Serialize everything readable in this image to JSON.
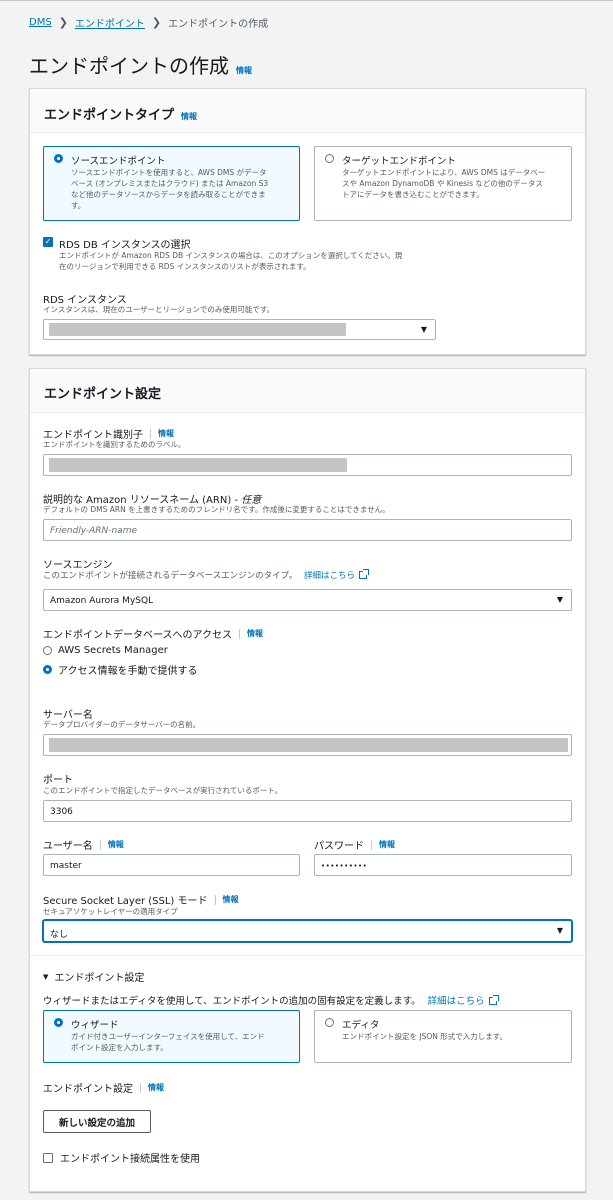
{
  "breadcrumb": {
    "root": "DMS",
    "parent": "エンドポイント",
    "current": "エンドポイントの作成"
  },
  "page": {
    "title": "エンドポイントの作成",
    "info": "情報"
  },
  "endpoint_type": {
    "title": "エンドポイントタイプ",
    "info": "情報",
    "source": {
      "title": "ソースエンドポイント",
      "desc1": "ソースエンドポイントを使用すると、AWS DMS がデータ",
      "desc2": "ベース (オンプレミスまたはクラウド) または Amazon S3",
      "desc3": "など他のデータソースからデータを読み取ることができま",
      "desc4": "す。"
    },
    "target": {
      "title": "ターゲットエンドポイント",
      "desc1": "ターゲットエンドポイントにより、AWS DMS はデータベー",
      "desc2": "スや Amazon DynamoDB や Kinesis などの他のデータス",
      "desc3": "トアにデータを書き込むことができます。"
    },
    "rds_select": {
      "label": "RDS DB インスタンスの選択",
      "desc1": "エンドポイントが Amazon RDS DB インスタンスの場合は、このオプションを選択してください。現",
      "desc2": "在のリージョンで利用できる RDS インスタンスのリストが表示されます。"
    },
    "rds_instance": {
      "label": "RDS インスタンス",
      "desc": "インスタンスは、現在のユーザーとリージョンでのみ使用可能です。"
    }
  },
  "endpoint_settings": {
    "title": "エンドポイント設定",
    "identifier": {
      "label": "エンドポイント識別子",
      "info": "情報",
      "desc": "エンドポイントを識別するためのラベル。"
    },
    "arn": {
      "label": "説明的な Amazon リソースネーム (ARN) -",
      "optional": "任意",
      "desc": "デフォルトの DMS ARN を上書きするためのフレンドリ名です。作成後に変更することはできません。",
      "placeholder": "Friendly-ARN-name"
    },
    "engine": {
      "label": "ソースエンジン",
      "desc": "このエンドポイントが接続されるデータベースエンジンのタイプ。",
      "learn_more": "詳細はこちら",
      "value": "Amazon Aurora MySQL"
    },
    "access": {
      "label": "エンドポイントデータベースへのアクセス",
      "info": "情報",
      "opt1": "AWS Secrets Manager",
      "opt2": "アクセス情報を手動で提供する"
    },
    "server": {
      "label": "サーバー名",
      "desc": "データプロバイダーのデータサーバーの名前。"
    },
    "port": {
      "label": "ポート",
      "desc": "このエンドポイントで指定したデータベースが実行されているポート。",
      "value": "3306"
    },
    "username": {
      "label": "ユーザー名",
      "info": "情報",
      "value": "master"
    },
    "password": {
      "label": "パスワード",
      "info": "情報",
      "value": "••••••••••"
    },
    "ssl": {
      "label": "Secure Socket Layer (SSL) モード",
      "info": "情報",
      "desc": "セキュアソケットレイヤーの適用タイプ",
      "value": "なし"
    },
    "advanced": {
      "toggle": "エンドポイント設定",
      "desc": "ウィザードまたはエディタを使用して、エンドポイントの追加の固有設定を定義します。",
      "learn_more": "詳細はこちら",
      "wizard": {
        "title": "ウィザード",
        "desc1": "ガイド付きユーザーインターフェイスを使用して、エンド",
        "desc2": "ポイント設定を入力します。"
      },
      "editor": {
        "title": "エディタ",
        "desc1": "エンドポイント設定を JSON 形式で入力します。"
      },
      "settings_label": "エンドポイント設定",
      "settings_info": "情報",
      "add_button": "新しい設定の追加",
      "conn_attr": "エンドポイント接続属性を使用"
    }
  },
  "colors": {
    "accent": "#0073bb",
    "link": "#0073bb",
    "background": "#f2f3f3"
  }
}
